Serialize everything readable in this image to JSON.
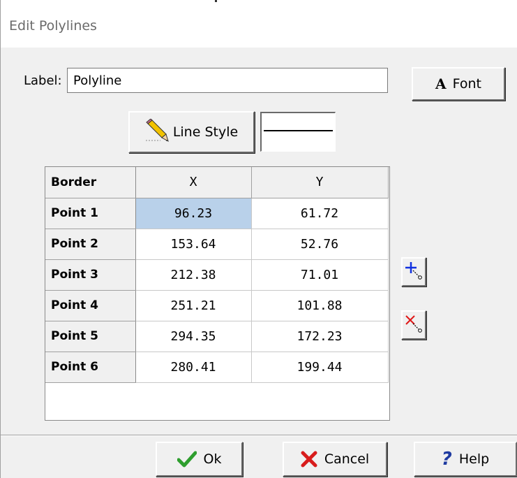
{
  "window": {
    "title": "Edit Polylines"
  },
  "label_field": {
    "caption": "Label:",
    "value": "Polyline"
  },
  "font_button": {
    "glyph": "A",
    "label": "Font"
  },
  "line_style_button": {
    "label": "Line Style",
    "icon": "pencil-icon"
  },
  "grid": {
    "headers": {
      "corner": "Border",
      "x": "X",
      "y": "Y"
    },
    "rows": [
      {
        "label": "Point 1",
        "x": "96.23",
        "y": "61.72"
      },
      {
        "label": "Point 2",
        "x": "153.64",
        "y": "52.76"
      },
      {
        "label": "Point 3",
        "x": "212.38",
        "y": "71.01"
      },
      {
        "label": "Point 4",
        "x": "251.21",
        "y": "101.88"
      },
      {
        "label": "Point 5",
        "x": "294.35",
        "y": "172.23"
      },
      {
        "label": "Point 6",
        "x": "280.41",
        "y": "199.44"
      }
    ]
  },
  "side_buttons": {
    "add_icon": "add-point-icon",
    "delete_icon": "delete-point-icon"
  },
  "footer": {
    "ok": "Ok",
    "cancel": "Cancel",
    "help": "Help"
  },
  "colors": {
    "selected_cell": "#b9d1ea",
    "dialog_bg": "#f0f0f0",
    "help_icon": "#1e3aa0",
    "check_icon": "#2e9e2e",
    "cancel_icon": "#e02020"
  }
}
